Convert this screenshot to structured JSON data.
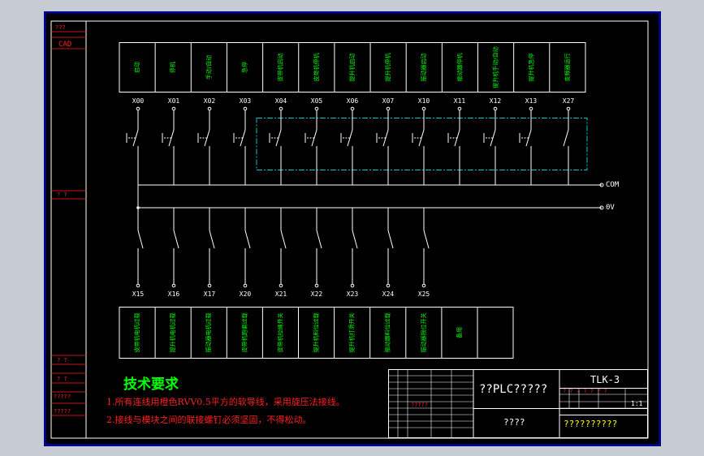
{
  "colors": {
    "background": "#c6cbd4",
    "sheet": "#000000",
    "frame": "#ffffff",
    "blue_frame": "#0000cc",
    "wire": "#ffffff",
    "dashed_box": "#00c8c8",
    "label": "#00ff00",
    "red_text": "#ff2020",
    "terminal": "#ffffff"
  },
  "side_labels": {
    "top": "???",
    "cad": "CAD",
    "mid": "? ?",
    "low1": "? ?",
    "low2": "? ?",
    "low3": "?????",
    "low4": "?????"
  },
  "inputs_top": [
    {
      "addr": "X00",
      "desc": "启动"
    },
    {
      "addr": "X01",
      "desc": "停机"
    },
    {
      "addr": "X02",
      "desc": "手动/自动"
    },
    {
      "addr": "X03",
      "desc": "急停"
    },
    {
      "addr": "X04",
      "desc": "皮带机启动"
    },
    {
      "addr": "X05",
      "desc": "皮带机停机"
    },
    {
      "addr": "X06",
      "desc": "提升机启动"
    },
    {
      "addr": "X07",
      "desc": "提升机停机"
    },
    {
      "addr": "X10",
      "desc": "振动器启动"
    },
    {
      "addr": "X11",
      "desc": "振动器停机"
    },
    {
      "addr": "X12",
      "desc": "提升机手动/自动"
    },
    {
      "addr": "X13",
      "desc": "提升机急停"
    },
    {
      "addr": "X27",
      "desc": "变频器运行"
    }
  ],
  "inputs_bottom": [
    {
      "addr": "X15",
      "desc": "皮带机电机过载"
    },
    {
      "addr": "X16",
      "desc": "提升机电机过载"
    },
    {
      "addr": "X17",
      "desc": "振动器电机过载"
    },
    {
      "addr": "X20",
      "desc": "皮带机跑偏过载"
    },
    {
      "addr": "X21",
      "desc": "皮带机拉绳开关"
    },
    {
      "addr": "X22",
      "desc": "提升机料位过载"
    },
    {
      "addr": "X23",
      "desc": "提升机打滑开关"
    },
    {
      "addr": "X24",
      "desc": "振动器料位过载"
    },
    {
      "addr": "X25",
      "desc": "振动器限位开关"
    },
    {
      "addr": "",
      "desc": "备用"
    },
    {
      "addr": "",
      "desc": ""
    }
  ],
  "bus": {
    "com": "COM",
    "ov": "0V"
  },
  "tech": {
    "title": "技术要求",
    "line1": "1.所有连线用橙色RVV0.5平方的软导线，采用旋压法接线。",
    "line2": "2.接线与模块之间的联接螺钉必须坚固，不得松动。"
  },
  "title_block": {
    "drawing_title": "??PLC?????",
    "sub_title": "????",
    "drawing_no": "TLK-3",
    "company": "??????????",
    "scale": "1:1",
    "row_text": "?????",
    "qmarks": "? ? ? ? ? ? ?"
  }
}
